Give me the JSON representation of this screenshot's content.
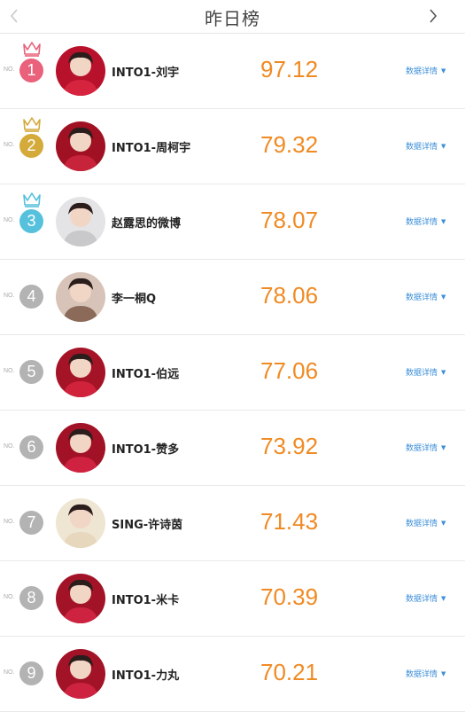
{
  "header": {
    "title": "昨日榜"
  },
  "no_label": "NO.",
  "detail_label": "数据详情",
  "rows": [
    {
      "rank": "1",
      "name": "INTO1-刘宇",
      "score": "97.12",
      "badge_color": "#e9617a",
      "crown_color": "#e9617a",
      "avatar_color": "#d6243f",
      "avatar_bg": "#b8112b"
    },
    {
      "rank": "2",
      "name": "INTO1-周柯宇",
      "score": "79.32",
      "badge_color": "#d4aa3b",
      "crown_color": "#d4aa3b",
      "avatar_color": "#c7233a",
      "avatar_bg": "#a01123"
    },
    {
      "rank": "3",
      "name": "赵露思的微博",
      "score": "78.07",
      "badge_color": "#56c1dc",
      "crown_color": "#56c1dc",
      "avatar_color": "#c9c9cc",
      "avatar_bg": "#e4e4e6"
    },
    {
      "rank": "4",
      "name": "李一桐Q",
      "score": "78.06",
      "badge_color": "#b3b3b3",
      "crown_color": "",
      "avatar_color": "#8b6a5a",
      "avatar_bg": "#d7c3b8"
    },
    {
      "rank": "5",
      "name": "INTO1-伯远",
      "score": "77.06",
      "badge_color": "#b3b3b3",
      "crown_color": "",
      "avatar_color": "#d1223c",
      "avatar_bg": "#a51327"
    },
    {
      "rank": "6",
      "name": "INTO1-赞多",
      "score": "73.92",
      "badge_color": "#b3b3b3",
      "crown_color": "",
      "avatar_color": "#cf2240",
      "avatar_bg": "#a11226"
    },
    {
      "rank": "7",
      "name": "SING-许诗茵",
      "score": "71.43",
      "badge_color": "#b3b3b3",
      "crown_color": "",
      "avatar_color": "#e6d7bd",
      "avatar_bg": "#efe5d3"
    },
    {
      "rank": "8",
      "name": "INTO1-米卡",
      "score": "70.39",
      "badge_color": "#b3b3b3",
      "crown_color": "",
      "avatar_color": "#cd2340",
      "avatar_bg": "#a21328"
    },
    {
      "rank": "9",
      "name": "INTO1-力丸",
      "score": "70.21",
      "badge_color": "#b3b3b3",
      "crown_color": "",
      "avatar_color": "#cd2340",
      "avatar_bg": "#a21328"
    }
  ]
}
